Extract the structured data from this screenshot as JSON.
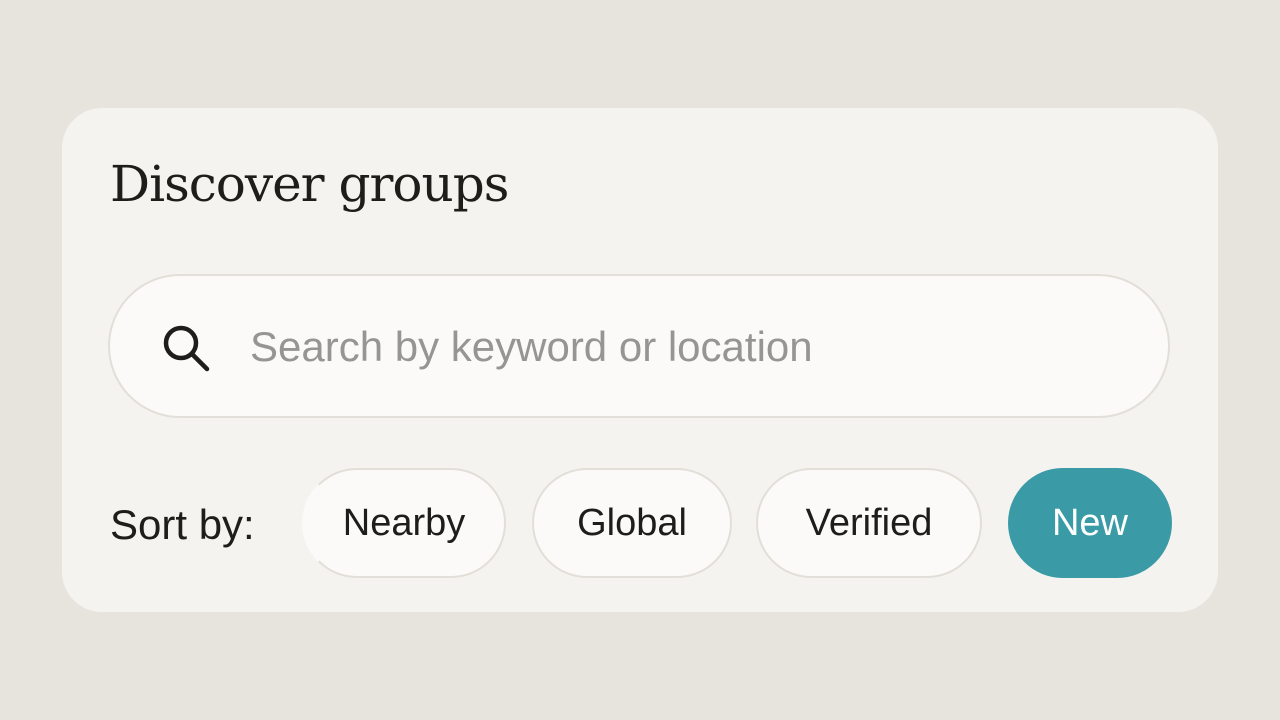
{
  "discover": {
    "title": "Discover groups",
    "search": {
      "placeholder": "Search by keyword or location",
      "value": "",
      "icon": "search-icon"
    },
    "sort": {
      "label": "Sort by:",
      "options": [
        "Nearby",
        "Global",
        "Verified",
        "New"
      ],
      "selected": "New"
    }
  },
  "colors": {
    "accent": "#3a9ba6",
    "background": "#e7e4de",
    "panel": "#f4f3f0",
    "text": "#1f1d1a",
    "placeholder": "#979592"
  }
}
